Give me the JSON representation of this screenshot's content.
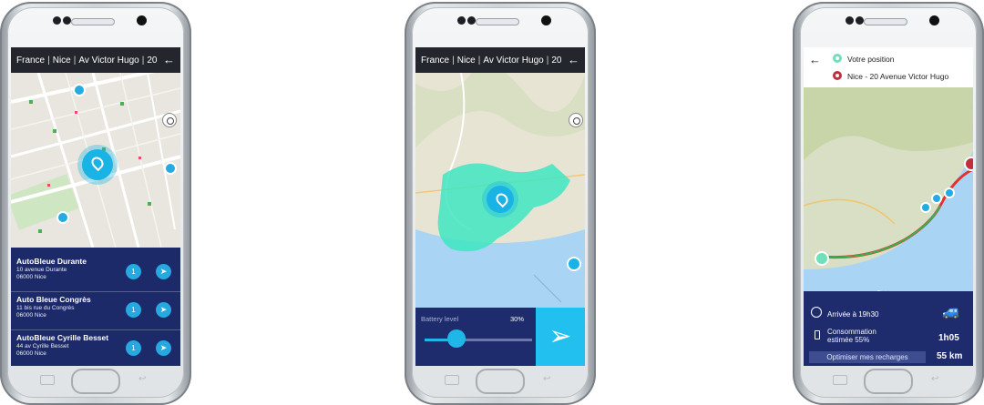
{
  "phone1": {
    "topbar": {
      "country": "France",
      "city": "Nice",
      "street": "Av Victor Hugo",
      "number": "20",
      "back_icon": "arrow-left-icon"
    },
    "stations": [
      {
        "name": "AutoBleue Durante",
        "address1": "10 avenue Durante",
        "address2": "06000 Nice",
        "badge": "1"
      },
      {
        "name": "Auto Bleue Congrès",
        "address1": "11 bis rue du Congrès",
        "address2": "06000 Nice",
        "badge": "1"
      },
      {
        "name": "AutoBleue Cyrille Besset",
        "address1": "44 av Cyrille Besset",
        "address2": "06000 Nice",
        "badge": "1"
      }
    ],
    "accent": "#19b3e6",
    "panel_color": "#1c2a69"
  },
  "phone2": {
    "topbar": {
      "country": "France",
      "city": "Nice",
      "street": "Av Victor Hugo",
      "number": "20",
      "back_icon": "arrow-left-icon"
    },
    "battery_label": "Battery level",
    "battery_value": "30%",
    "battery_fraction": 0.3,
    "zone_color": "#3ee6c1"
  },
  "phone3": {
    "origin": "Votre position",
    "destination": "Nice - 20 Avenue Victor Hugo",
    "arrival": "Arrivée à 19h30",
    "consumption_line1": "Consommation",
    "consumption_line2": "estimée 55%",
    "optimize_button": "Optimiser mes recharges",
    "duration": "1h05",
    "distance": "55 km",
    "route_color": "#e2312f"
  }
}
